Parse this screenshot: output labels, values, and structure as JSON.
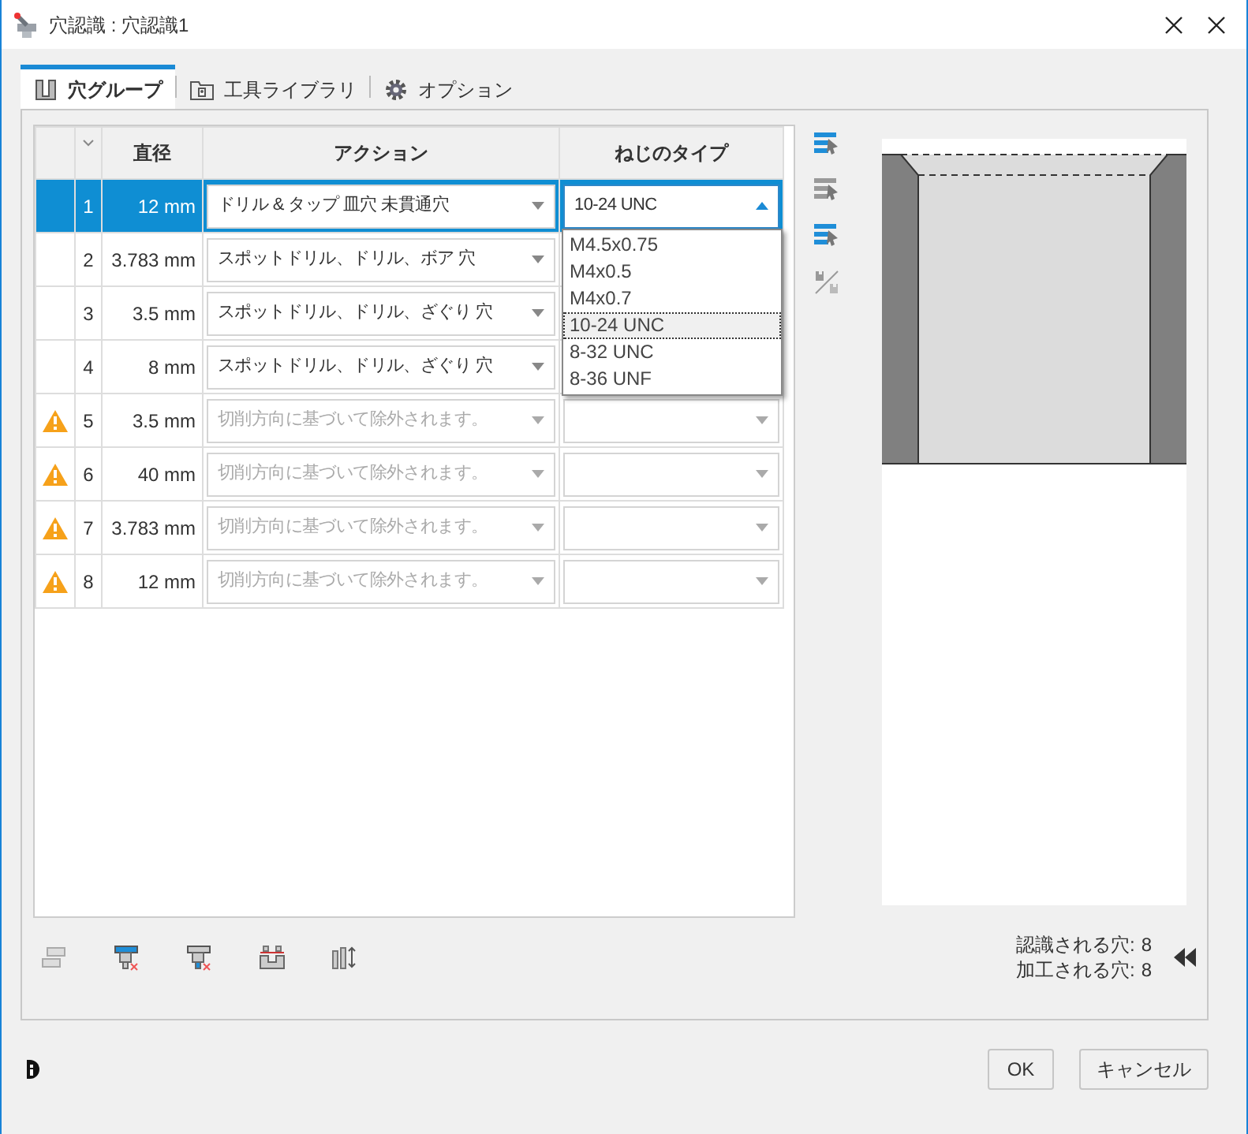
{
  "window": {
    "title": "穴認識 : 穴認識1"
  },
  "tabs": [
    {
      "label": "穴グループ",
      "selected": true
    },
    {
      "label": "工具ライブラリ",
      "selected": false
    },
    {
      "label": "オプション",
      "selected": false
    }
  ],
  "table": {
    "columns": [
      "直径",
      "アクション",
      "ねじのタイプ"
    ],
    "rows": [
      {
        "number": "1",
        "diameter": "12 mm",
        "action": "ドリル & タップ 皿穴 未貫通穴",
        "thread": "10-24 UNC",
        "selected": true,
        "warning": false,
        "disabled": false,
        "expanded": true
      },
      {
        "number": "2",
        "diameter": "3.783 mm",
        "action": "スポットドリル、ドリル、ボア 穴",
        "selected": false,
        "warning": false,
        "disabled": false,
        "expanded": false
      },
      {
        "number": "3",
        "diameter": "3.5 mm",
        "action": "スポットドリル、ドリル、ざぐり 穴",
        "selected": false,
        "warning": false,
        "disabled": false,
        "expanded": false
      },
      {
        "number": "4",
        "diameter": "8 mm",
        "action": "スポットドリル、ドリル、ざぐり 穴",
        "selected": false,
        "warning": false,
        "disabled": false,
        "expanded": false
      },
      {
        "number": "5",
        "diameter": "3.5 mm",
        "action": "切削方向に基づいて除外されます。",
        "selected": false,
        "warning": true,
        "disabled": true,
        "expanded": false
      },
      {
        "number": "6",
        "diameter": "40 mm",
        "action": "切削方向に基づいて除外されます。",
        "selected": false,
        "warning": true,
        "disabled": true,
        "expanded": false
      },
      {
        "number": "7",
        "diameter": "3.783 mm",
        "action": "切削方向に基づいて除外されます。",
        "selected": false,
        "warning": true,
        "disabled": true,
        "expanded": false
      },
      {
        "number": "8",
        "diameter": "12 mm",
        "action": "切削方向に基づいて除外されます。",
        "selected": false,
        "warning": true,
        "disabled": true,
        "expanded": false
      }
    ]
  },
  "thread_options": [
    {
      "label": "M4.5x0.75",
      "selected": false
    },
    {
      "label": "M4x0.5",
      "selected": false
    },
    {
      "label": "M4x0.7",
      "selected": false
    },
    {
      "label": "10-24 UNC",
      "selected": true
    },
    {
      "label": "8-32 UNC",
      "selected": false
    },
    {
      "label": "8-36 UNF",
      "selected": false
    }
  ],
  "counts": [
    {
      "label": "認識される穴:",
      "value": "8"
    },
    {
      "label": "加工される穴:",
      "value": "8"
    }
  ],
  "buttons": [
    "OK",
    "キャンセル"
  ]
}
